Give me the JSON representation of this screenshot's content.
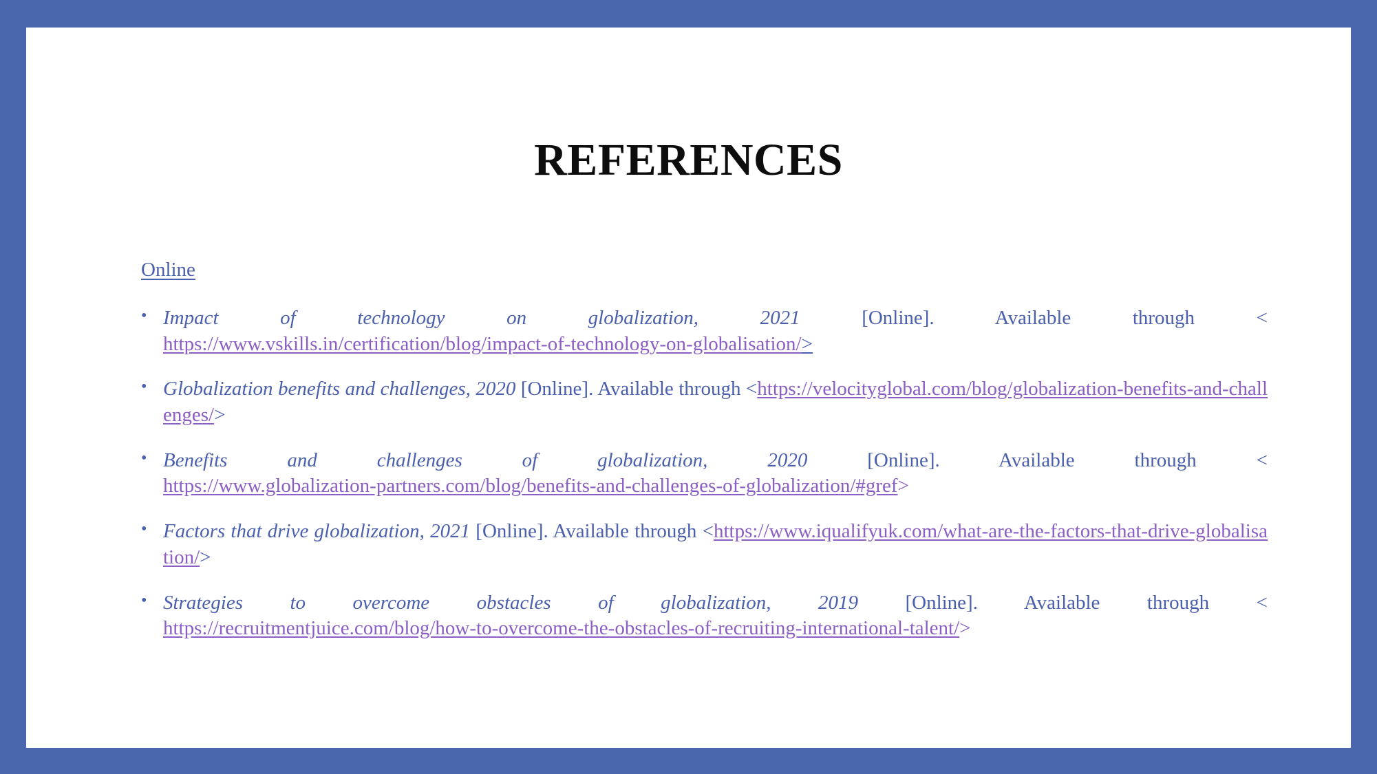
{
  "theme": {
    "border_color": "#4a66ad",
    "slide_background": "#ffffff",
    "title_color": "#0d0d0d",
    "text_color": "#4a5fae",
    "link_color": "#8a5ec4"
  },
  "slide": {
    "title": "REFERENCES",
    "section_heading": "Online ",
    "bullet_glyph": "•",
    "references": [
      {
        "title": "Impact of technology on globalization, 2021",
        "availability": "[Online]. Available through <",
        "url": "https://www.vskills.in/certification/blog/impact-of-technology-on-globalisation/",
        "close": ">"
      },
      {
        "title": "Globalization benefits and challenges, 2020",
        "availability": "[Online]. Available through <",
        "url": "https://velocityglobal.com/blog/globalization-benefits-and-challenges/",
        "close": ">"
      },
      {
        "title": "Benefits and challenges of globalization, 2020",
        "availability": "[Online]. Available through <",
        "url": "https://www.globalization-partners.com/blog/benefits-and-challenges-of-globalization/#gref",
        "close": ">"
      },
      {
        "title": "Factors that drive globalization, 2021",
        "availability": "[Online]. Available through <",
        "url": "https://www.iqualifyuk.com/what-are-the-factors-that-drive-globalisation/",
        "close": ">"
      },
      {
        "title": "Strategies to overcome obstacles of globalization, 2019",
        "availability": "[Online]. Available through <",
        "url": "https://recruitmentjuice.com/blog/how-to-overcome-the-obstacles-of-recruiting-international-talent/",
        "close": ">"
      }
    ]
  }
}
